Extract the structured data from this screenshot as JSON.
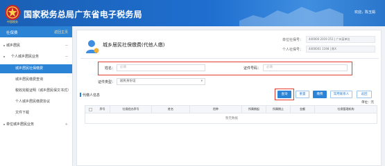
{
  "header": {
    "title": "国家税务总局广东省电子税务局",
    "emblem_text": "中国税务",
    "welcome": "欢迎，",
    "user": "陈玉娟"
  },
  "sidebar": {
    "title": "社保费",
    "back": "返回主页",
    "items": [
      {
        "label": "城乡居民",
        "arrow": "−"
      },
      {
        "label": "个人城乡居民业务",
        "arrow": "−"
      },
      {
        "label": "城乡居民社保缴费"
      },
      {
        "label": "城乡居民缴费查询"
      },
      {
        "label": "税收完税证明（城乡居民保文书式）"
      },
      {
        "label": "个人城乡居民缴费协议"
      },
      {
        "label": "文件下载"
      },
      {
        "label": "单位城乡居民业务",
        "arrow": "+"
      }
    ]
  },
  "main": {
    "title": "城乡居民社保缴费(代他人缴)",
    "unit_id_label": "单位社保号：",
    "unit_id_value": "440000 2019 251 | 广州某单位",
    "person_id_label": "个人社保号：",
    "person_id_value": "4400001 1198 | 陈X",
    "search": {
      "name_label": "姓名：",
      "name_placeholder": "必填",
      "id_label": "证件号码：",
      "id_placeholder": "必填",
      "id_type_label": "证件类型：",
      "id_type_value": "居民身份证"
    },
    "section_title": "代缴人信息",
    "buttons": {
      "query": "查询",
      "reset": "重置",
      "pay": "缴费",
      "common_contacts": "常用联系人",
      "back": "返回"
    },
    "unit_label": "单位：元",
    "table": {
      "columns": [
        "序号",
        "社保经办序号",
        "姓名",
        "险种",
        "所属期起",
        "所属期止",
        "金额",
        "社保管理机构"
      ],
      "empty_text": "暂无数据"
    }
  }
}
